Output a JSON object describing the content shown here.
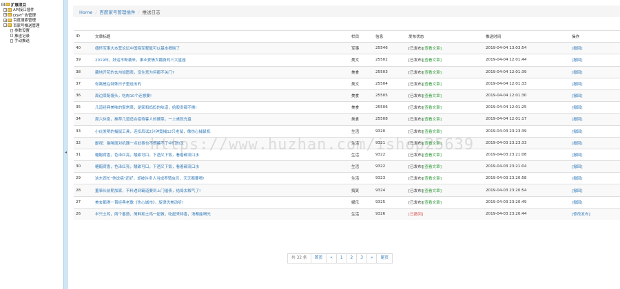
{
  "sidebar": {
    "root": "扩展项目",
    "items": [
      {
        "label": "API接口插件"
      },
      {
        "label": "DSP广告管理"
      },
      {
        "label": "百度搜索管理"
      },
      {
        "label": "百家号推送管理",
        "children": [
          "参数设置",
          "推送记录",
          "手动推送"
        ]
      }
    ]
  },
  "splitter": {
    "arrow": "◂"
  },
  "breadcrumb": {
    "home": "Home",
    "plugin": "百度家号管理插件",
    "current": "推送日志"
  },
  "table": {
    "headers": [
      "ID",
      "文章标题",
      "栏目",
      "信息",
      "发布状态",
      "推送时间",
      "操作"
    ],
    "rows": [
      {
        "id": "40",
        "title": "缅怀军事大本营论坛中国海军舰艇可以基本揭晓了",
        "col": "军事",
        "info": "25546",
        "status_pre": "[已发布]",
        "status_link": "[查看文章]",
        "status_red": "",
        "time": "2019-04-04 13:03:54",
        "op": "[撤回]"
      },
      {
        "id": "39",
        "title": "2019年，好运不断袭来，事业爱情大翻身的三大星座",
        "col": "美文",
        "info": "25502",
        "status_pre": "[已发布]",
        "status_link": "[查看文章]",
        "status_red": "",
        "time": "2019-04-04 12:01:44",
        "op": "[撤回]"
      },
      {
        "id": "38",
        "title": "藏地开花的玄州如图表，没生意为何都不关门?",
        "col": "美食",
        "info": "25503",
        "status_pre": "[已发布]",
        "status_link": "[查看文章]",
        "status_red": "",
        "time": "2019-04-04 12:01:39",
        "op": "[撤回]"
      },
      {
        "id": "37",
        "title": "你离是在特殊日子里送出的",
        "col": "美文",
        "info": "25504",
        "status_pre": "[已发布]",
        "status_link": "[查看文章]",
        "status_red": "",
        "time": "2019-04-04 12:01:33",
        "op": "[撤回]"
      },
      {
        "id": "36",
        "title": "周边菜配馒头，吃肉10个还想要!",
        "col": "美食",
        "info": "25505",
        "status_pre": "[已发布]",
        "status_link": "[查看文章]",
        "status_red": "",
        "time": "2019-04-04 12:01:30",
        "op": "[撤回]"
      },
      {
        "id": "35",
        "title": "几道经典美味的家常菜，是家和妈妈的味道，给般贵都不换!",
        "col": "美食",
        "info": "25506",
        "status_pre": "[已发布]",
        "status_link": "[查看文章]",
        "status_red": "",
        "time": "2019-04-04 12:01:25",
        "op": "[撤回]"
      },
      {
        "id": "34",
        "title": "周六休息，推荐几道适合招待客人的硬菜，一上桌就光盘",
        "col": "美食",
        "info": "25508",
        "status_pre": "[已发布]",
        "status_link": "[查看文章]",
        "status_red": "",
        "time": "2019-04-04 12:01:17",
        "op": "[撤回]"
      },
      {
        "id": "33",
        "title": "小伙发明的捕鼠工具，连扣后试2分钟竟捕12只老鼠，像伤心捕鼠机",
        "col": "生活",
        "info": "9320",
        "status_pre": "[已发布]",
        "status_link": "[查看文章]",
        "status_red": "",
        "time": "2019-04-03 23:23:39",
        "op": "[撤回]"
      },
      {
        "id": "32",
        "title": "鄙视：猫咪面对机器一点处事也不愤骗不了中们的汉",
        "col": "生活",
        "info": "9321",
        "status_pre": "[已发布]",
        "status_link": "[查看文章]",
        "status_red": "",
        "time": "2019-04-03 23:23:33",
        "op": "[撤回]"
      },
      {
        "id": "31",
        "title": "糖醋荷香，色泽红亮，酸甜可口，下酒又下饭，看着都流口水",
        "col": "生活",
        "info": "9322",
        "status_pre": "[已发布]",
        "status_link": "[查看文章]",
        "status_red": "",
        "time": "2019-04-03 23:21:08",
        "op": "[撤回]"
      },
      {
        "id": "30",
        "title": "糖醋荷香，色泽红亮，酸甜可口，下酒又下饭，看着都流口水",
        "col": "生活",
        "info": "9322",
        "status_pre": "[已发布]",
        "status_link": "[查看文章]",
        "status_red": "",
        "time": "2019-04-03 23:21:04",
        "op": "[撤回]"
      },
      {
        "id": "29",
        "title": "这东西忙\"他说搞\"还好，却被许多人当成养殖虫贝，天天都要喝!",
        "col": "生活",
        "info": "9323",
        "status_pre": "[已发布]",
        "status_link": "[查看文章]",
        "status_red": "",
        "time": "2019-04-03 23:20:58",
        "op": "[撤回]"
      },
      {
        "id": "28",
        "title": "董事长前期加家，不料遇到霸道要到上门催债，结局太解气了!",
        "col": "搞笑",
        "info": "9324",
        "status_pre": "[已发布]",
        "status_link": "[查看文章]",
        "status_red": "",
        "time": "2019-04-03 23:20:54",
        "op": "[撤回]"
      },
      {
        "id": "27",
        "title": "美女都得一首经典老歌《伤心城市》，旋律优美动听!",
        "col": "娱乐",
        "info": "9325",
        "status_pre": "[已发布]",
        "status_link": "[查看文章]",
        "status_red": "",
        "time": "2019-04-03 23:20:49",
        "op": "[撤回]"
      },
      {
        "id": "26",
        "title": "半只土鸡，两个番茄，简鲜和土鸡一起做，吃起来特香，汤都能喝光",
        "col": "生活",
        "info": "9326",
        "status_pre": "",
        "status_link": "",
        "status_red": "[已撤回]",
        "time": "2019-04-03 23:20:44",
        "op": "[修改发布]"
      }
    ]
  },
  "pager": {
    "total": "共 32 条",
    "first": "首页",
    "prev": "«",
    "pages": [
      "1",
      "2",
      "3"
    ],
    "next": "»",
    "last": "尾页"
  },
  "watermark": "https://www.huzhan.com/ishop25639"
}
